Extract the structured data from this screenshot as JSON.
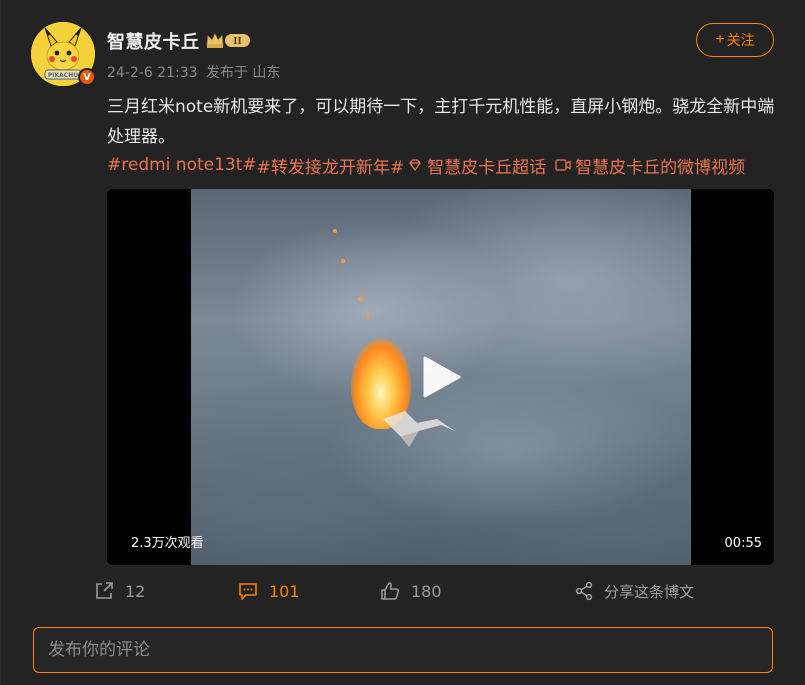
{
  "author": {
    "name": "智慧皮卡丘",
    "avatar_label": "PIKACHU",
    "verified_badge": "V",
    "level_badge": "II"
  },
  "meta": {
    "time": "24-2-6 21:33",
    "source": "发布于 山东"
  },
  "follow": {
    "plus": "+",
    "label": "关注"
  },
  "post": {
    "text": "三月红米note新机要来了，可以期待一下，主打千元机性能，直屏小钢炮。骁龙全新中端处理器。",
    "tags": {
      "tag1": "#redmi note13t#",
      "tag2": "#转发接龙开新年#",
      "supertopic": "智慧皮卡丘超话",
      "video_link": "智慧皮卡丘的微博视频"
    }
  },
  "video": {
    "views": "2.3万次观看",
    "duration": "00:55"
  },
  "actions": {
    "repost_count": "12",
    "comment_count": "101",
    "like_count": "180",
    "share_label": "分享这条博文"
  },
  "comment_input": {
    "placeholder": "发布你的评论"
  },
  "colors": {
    "accent": "#ff8200",
    "tag": "#eb7350",
    "background": "#232323"
  }
}
